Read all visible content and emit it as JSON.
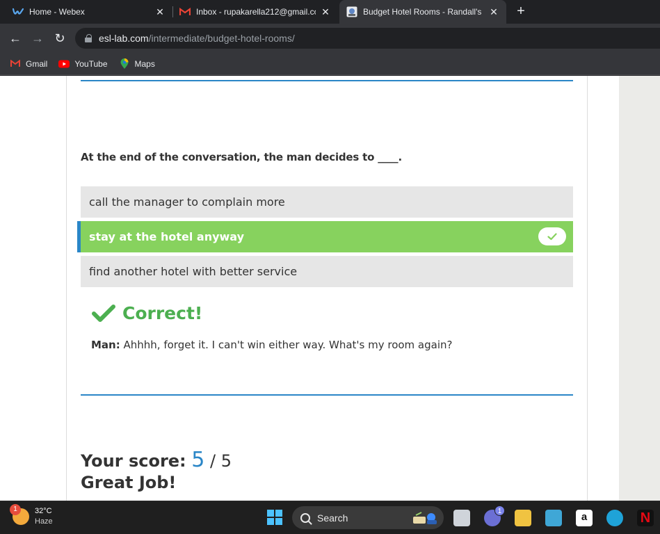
{
  "tabs": [
    {
      "title": "Home - Webex",
      "icon": "webex-icon",
      "active": false
    },
    {
      "title": "Inbox - rupakarella212@gmail.co",
      "icon": "gmail-icon",
      "active": false
    },
    {
      "title": "Budget Hotel Rooms - Randall's",
      "icon": "esl-lab-icon",
      "active": true
    }
  ],
  "toolbar": {
    "url_host": "esl-lab.com",
    "url_path": "/intermediate/budget-hotel-rooms/"
  },
  "bookmarks": [
    {
      "label": "Gmail",
      "icon": "gmail-icon"
    },
    {
      "label": "YouTube",
      "icon": "youtube-icon"
    },
    {
      "label": "Maps",
      "icon": "maps-icon"
    }
  ],
  "quiz": {
    "question": "At the end of the conversation, the man decides to ____.",
    "options": [
      {
        "text": "call the manager to complain more",
        "state": "default"
      },
      {
        "text": "stay at the hotel anyway",
        "state": "correct-selected"
      },
      {
        "text": "find another hotel with better service",
        "state": "default"
      }
    ],
    "feedback_title": "Correct!",
    "feedback_speaker": "Man:",
    "feedback_line": "Ahhhh, forget it. I can't win either way. What's my room again?"
  },
  "score": {
    "label": "Your score:",
    "value": "5",
    "separator_total": "/ 5",
    "message": "Great Job!"
  },
  "taskbar": {
    "weather_temp": "32°C",
    "weather_condition": "Haze",
    "weather_badge": "1",
    "search_label": "Search",
    "teams_badge": "1"
  },
  "colors": {
    "accent_blue": "#2a86c7",
    "correct_green": "#87d25e",
    "feedback_green": "#4caf50"
  }
}
